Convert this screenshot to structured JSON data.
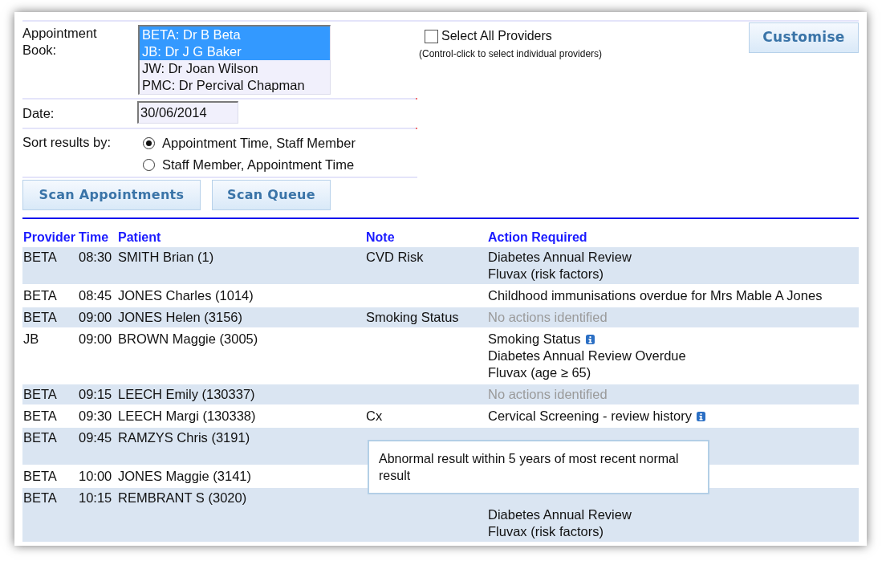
{
  "form": {
    "appointment_book": {
      "label": "Appointment Book:",
      "options": [
        {
          "label": "BETA: Dr B Beta",
          "selected": true
        },
        {
          "label": "JB: Dr J G Baker",
          "selected": true
        },
        {
          "label": "JW: Dr Joan Wilson",
          "selected": false
        },
        {
          "label": "PMC: Dr Percival Chapman",
          "selected": false
        }
      ]
    },
    "select_all": {
      "label": "Select All Providers",
      "checked": false,
      "hint": "(Control-click to select individual providers)"
    },
    "customise_button": "Customise",
    "date": {
      "label": "Date:",
      "value": "30/06/2014"
    },
    "sort": {
      "label": "Sort results by:",
      "options": [
        {
          "label": "Appointment Time, Staff Member",
          "selected": true
        },
        {
          "label": "Staff Member, Appointment Time",
          "selected": false
        }
      ]
    },
    "buttons": [
      "Scan Appointments",
      "Scan Queue"
    ]
  },
  "table": {
    "columns": [
      "Provider",
      "Time",
      "Patient",
      "Note",
      "Action Required"
    ],
    "rows": [
      {
        "provider": "BETA",
        "time": "08:30",
        "patient": "SMITH Brian (1)",
        "note": "CVD Risk",
        "actions": [
          {
            "text": "Diabetes Annual Review",
            "kind": "action",
            "info": false
          },
          {
            "text": "Fluvax (risk factors)",
            "kind": "action",
            "info": false
          }
        ]
      },
      {
        "provider": "BETA",
        "time": "08:45",
        "patient": "JONES Charles (1014)",
        "actions": [
          {
            "text": "Childhood immunisations overdue for Mrs Mable A Jones",
            "kind": "action",
            "info": false
          }
        ]
      },
      {
        "provider": "BETA",
        "time": "09:00",
        "patient": "JONES Helen (3156)",
        "note": "Smoking Status",
        "actions": [
          {
            "text": "No actions identified",
            "kind": "none",
            "info": false
          }
        ]
      },
      {
        "provider": "JB",
        "time": "09:00",
        "patient": "BROWN Maggie (3005)",
        "actions": [
          {
            "text": "Smoking Status",
            "kind": "action",
            "info": true
          },
          {
            "text": "Diabetes Annual Review Overdue",
            "kind": "action",
            "info": false
          },
          {
            "text": "Fluvax (age ≥ 65)",
            "kind": "action",
            "info": false
          }
        ]
      },
      {
        "provider": "BETA",
        "time": "09:15",
        "patient": "LEECH Emily (130337)",
        "actions": [
          {
            "text": "No actions identified",
            "kind": "none",
            "info": false
          }
        ]
      },
      {
        "provider": "BETA",
        "time": "09:30",
        "patient": "LEECH Margi (130338)",
        "note": "Cx",
        "actions": [
          {
            "text": "Cervical Screening - review history",
            "kind": "action",
            "info": true,
            "tooltip": "Abnormal result within 5 years of most recent normal result"
          }
        ]
      },
      {
        "provider": "BETA",
        "time": "09:45",
        "patient": "RAMZYS Chris (3191)",
        "actions": [
          {
            "kind": "covered"
          },
          {
            "kind": "covered"
          }
        ]
      },
      {
        "provider": "BETA",
        "time": "10:00",
        "patient": "JONES Maggie (3141)",
        "actions": [
          {
            "kind": "covered"
          }
        ]
      },
      {
        "provider": "BETA",
        "time": "10:15",
        "patient": "REMBRANT S (3020)",
        "actions": [
          {
            "kind": "covered"
          },
          {
            "text": "Diabetes Annual Review",
            "kind": "action",
            "info": false
          },
          {
            "text": "Fluvax (risk factors)",
            "kind": "action",
            "info": false
          }
        ]
      }
    ]
  }
}
